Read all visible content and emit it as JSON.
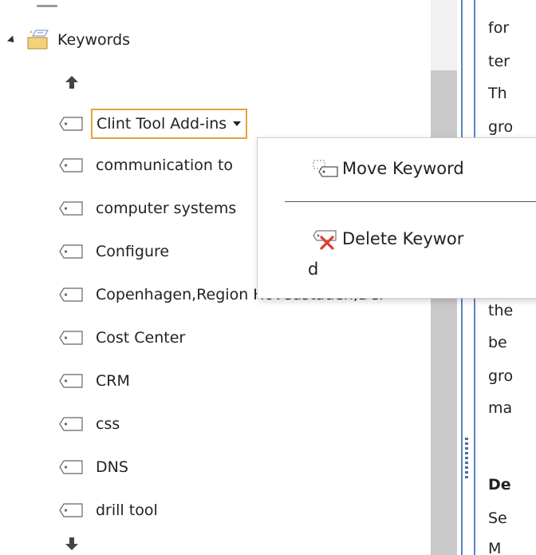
{
  "tree": {
    "root_label": "Keywords",
    "root_icon": "keywords-folder-icon",
    "selected": {
      "label": "Clint Tool Add-ins"
    },
    "items": [
      "communication to",
      "computer systems",
      "Configure",
      "Copenhagen,Region Hovedstaden,Der",
      "Cost Center",
      "CRM",
      "css",
      "DNS",
      "drill tool"
    ],
    "selection_color": "#e8a23c"
  },
  "context_menu": {
    "move_label": "Move Keyword",
    "delete_label": "Delete Keywor",
    "delete_wrap": "d"
  },
  "document": {
    "lines": [
      "for",
      "ter",
      "Th",
      "gro",
      "the",
      "be",
      "gro",
      "ma",
      "Se",
      "M"
    ],
    "heading": "De"
  },
  "colors": {
    "pane_border": "#5b83c1",
    "delete_x": "#e03c2e"
  }
}
